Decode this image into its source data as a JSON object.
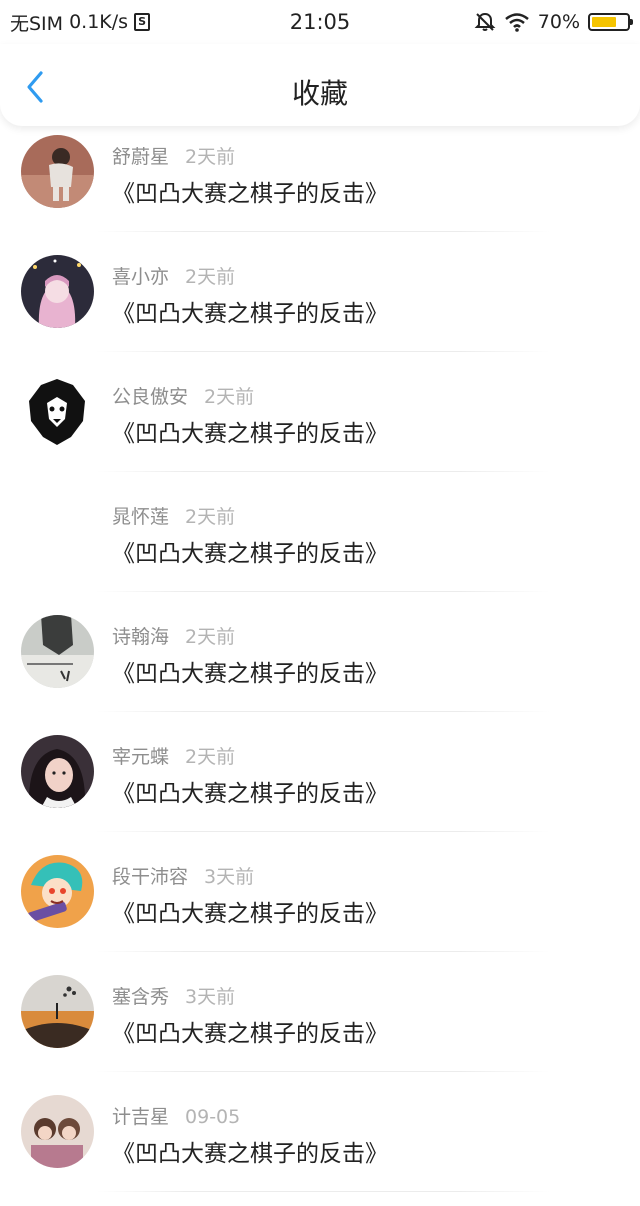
{
  "status_bar": {
    "carrier": "无SIM",
    "speed": "0.1K/s",
    "time": "21:05",
    "battery": "70%",
    "battery_level": 0.7
  },
  "nav": {
    "title": "收藏"
  },
  "items": [
    {
      "user": "舒蔚星",
      "time": "2天前",
      "title": "《凹凸大赛之棋子的反击》"
    },
    {
      "user": "喜小亦",
      "time": "2天前",
      "title": "《凹凸大赛之棋子的反击》"
    },
    {
      "user": "公良傲安",
      "time": "2天前",
      "title": "《凹凸大赛之棋子的反击》"
    },
    {
      "user": "晁怀莲",
      "time": "2天前",
      "title": "《凹凸大赛之棋子的反击》"
    },
    {
      "user": "诗翰海",
      "time": "2天前",
      "title": "《凹凸大赛之棋子的反击》"
    },
    {
      "user": "宰元蝶",
      "time": "2天前",
      "title": "《凹凸大赛之棋子的反击》"
    },
    {
      "user": "段干沛容",
      "time": "3天前",
      "title": "《凹凸大赛之棋子的反击》"
    },
    {
      "user": "塞含秀",
      "time": "3天前",
      "title": "《凹凸大赛之棋子的反击》"
    },
    {
      "user": "计吉星",
      "time": "09-05",
      "title": "《凹凸大赛之棋子的反击》"
    }
  ],
  "colors": {
    "accent": "#2f9bf0",
    "battery": "#f5c400"
  }
}
